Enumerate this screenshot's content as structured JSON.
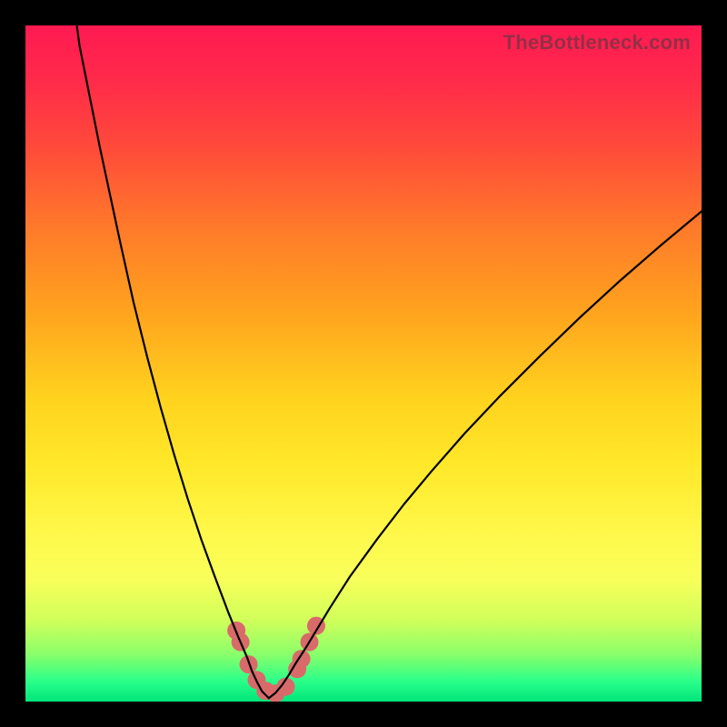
{
  "watermark": "TheBottleneck.com",
  "chart_data": {
    "type": "line",
    "title": "",
    "xlabel": "",
    "ylabel": "",
    "xlim": [
      0,
      100
    ],
    "ylim": [
      0,
      100
    ],
    "grid": false,
    "legend": false,
    "series": [
      {
        "name": "left-curve",
        "x": [
          7.6,
          8,
          9,
          10,
          11,
          12.5,
          14,
          16,
          18,
          20,
          22,
          24,
          26,
          28,
          30,
          31.5,
          32.8,
          33.5,
          34.3,
          35,
          36
        ],
        "y": [
          100,
          97,
          92,
          87,
          82,
          75,
          68,
          59,
          51,
          43.5,
          36.5,
          30,
          24,
          18.5,
          13.2,
          9.5,
          6.5,
          4.5,
          2.8,
          1.5,
          0.5
        ]
      },
      {
        "name": "right-curve",
        "x": [
          36,
          37,
          38,
          39,
          40,
          41.5,
          43,
          45,
          48,
          52,
          56,
          60,
          65,
          70,
          76,
          82,
          88,
          94,
          100
        ],
        "y": [
          0.5,
          1.3,
          2.5,
          4,
          5.7,
          8,
          10.5,
          13.8,
          18.5,
          24,
          29.2,
          34,
          39.7,
          45,
          51,
          56.8,
          62.3,
          67.5,
          72.5
        ]
      }
    ],
    "markers": {
      "name": "highlight-dots",
      "x": [
        31.2,
        31.8,
        33,
        34.2,
        35.5,
        37,
        38.5,
        40.2,
        40.8,
        42,
        43
      ],
      "y": [
        10.5,
        8.8,
        5.5,
        3.2,
        1.6,
        1.2,
        2.2,
        4.8,
        6.3,
        8.8,
        11.2
      ],
      "color": "#d96a6a",
      "radius_px": 10
    }
  }
}
